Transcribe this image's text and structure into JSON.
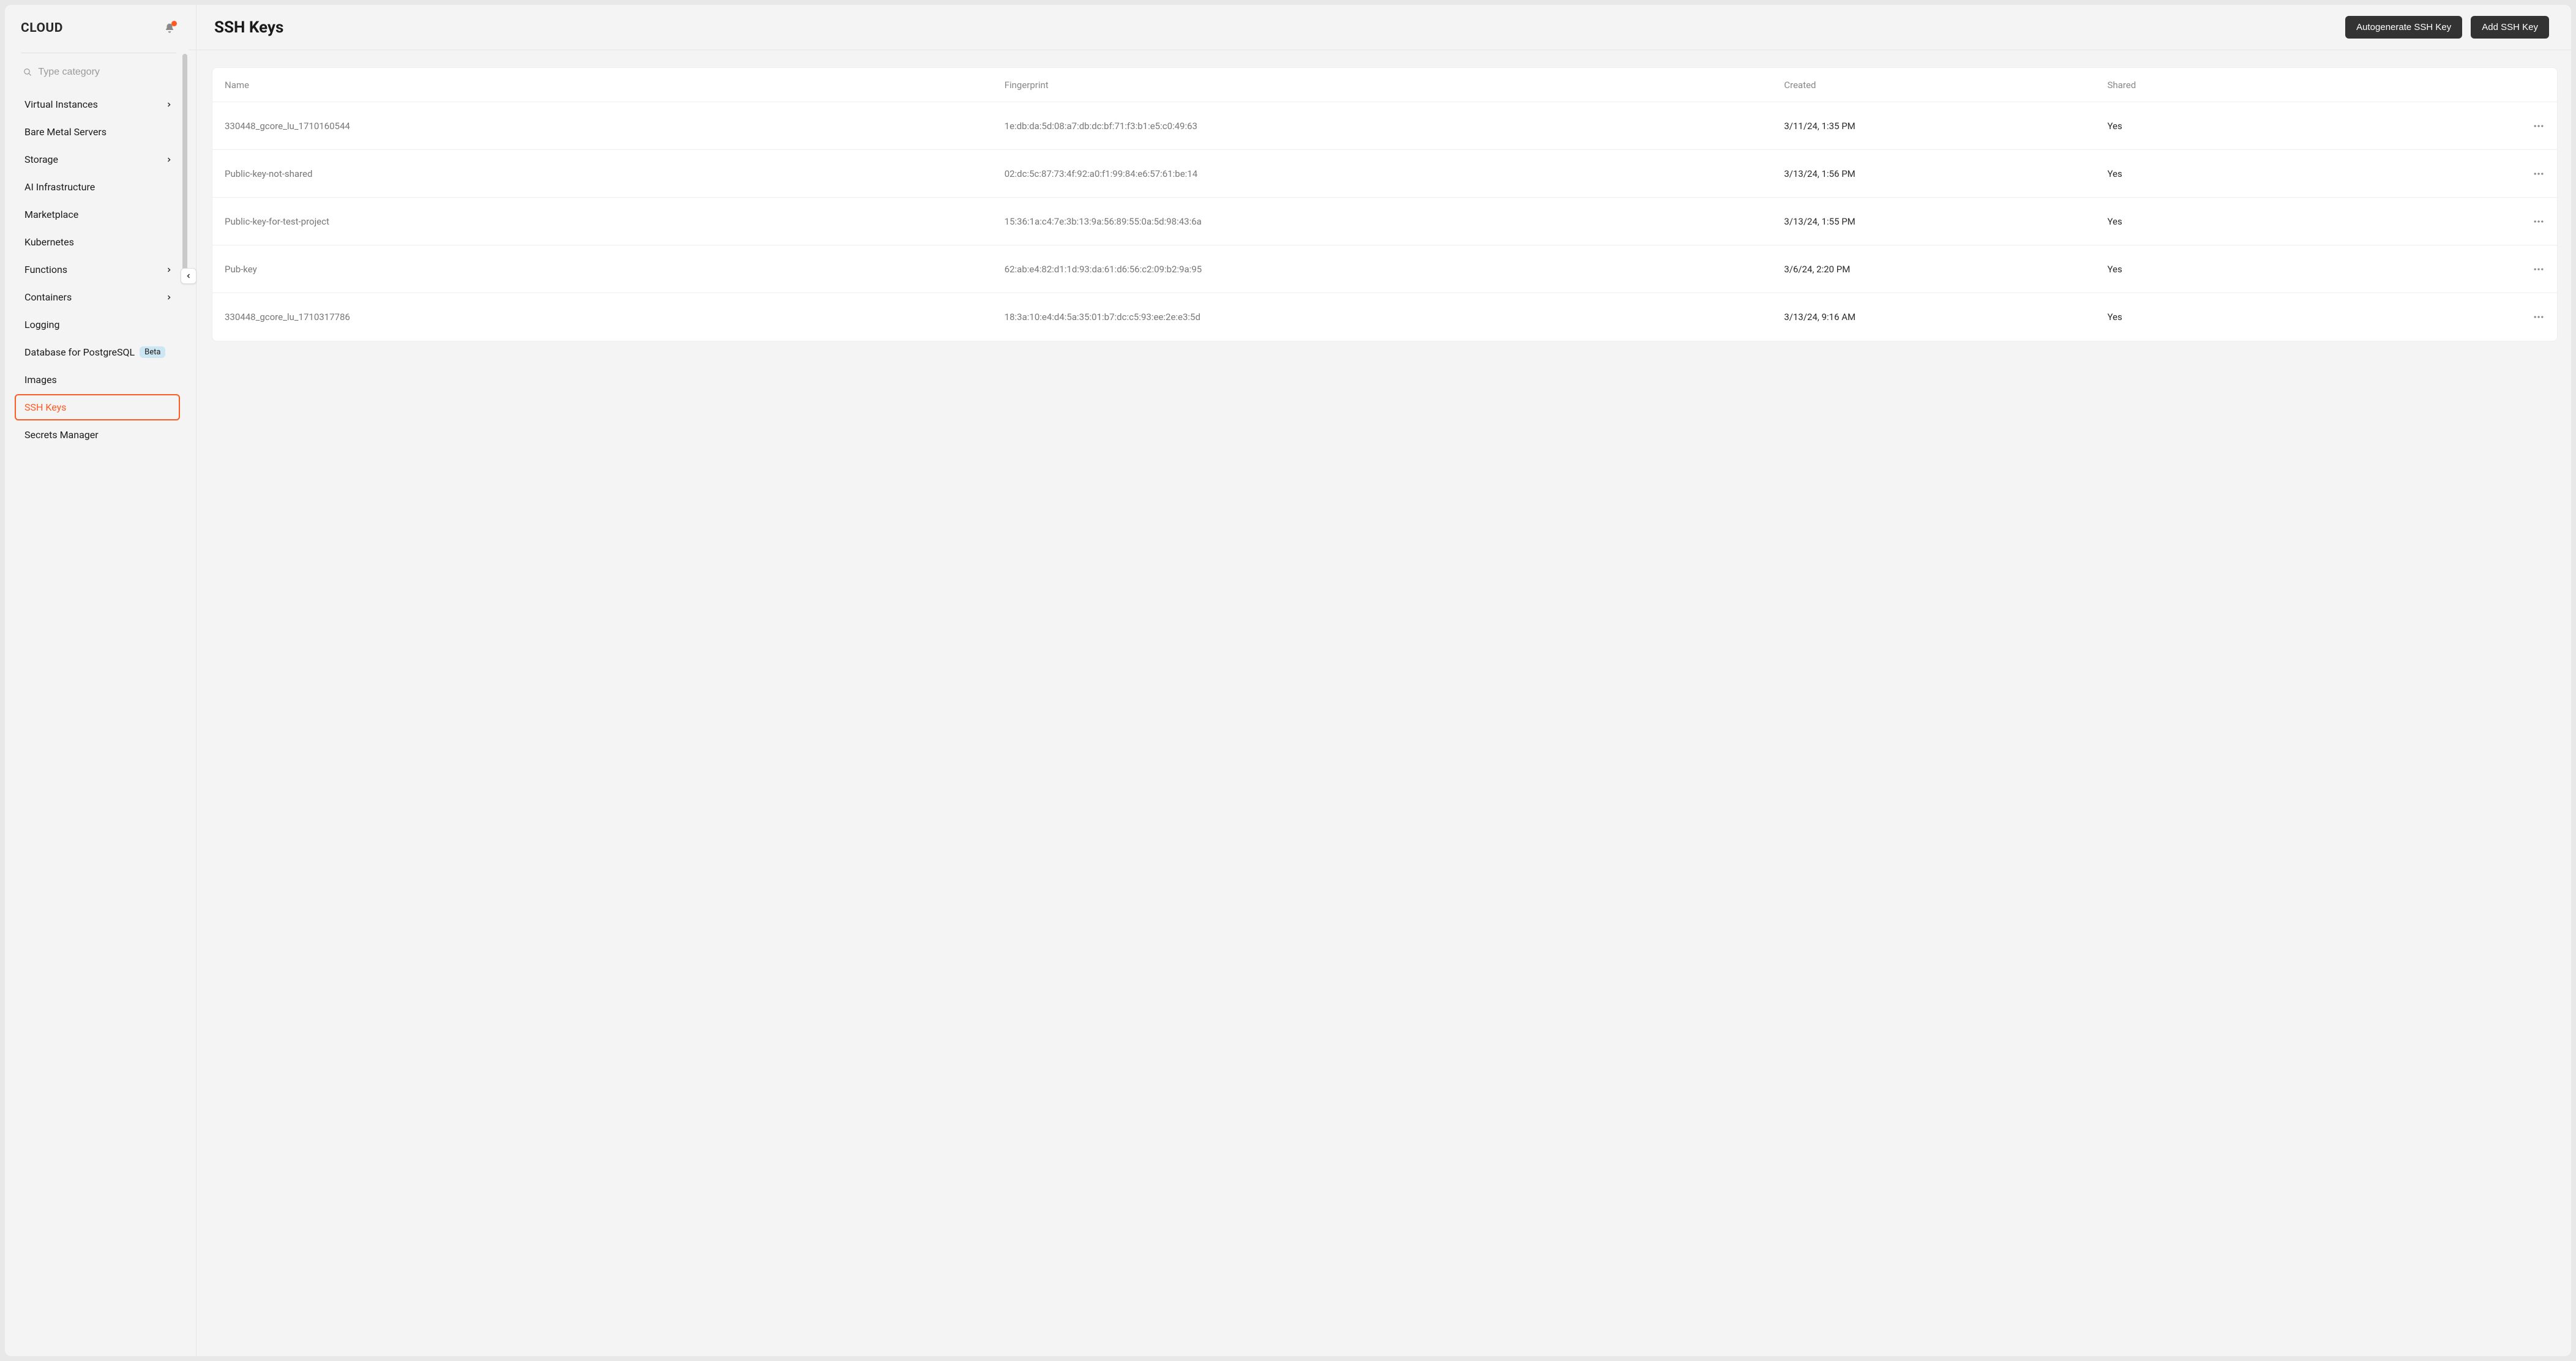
{
  "brand": "CLOUD",
  "search": {
    "placeholder": "Type category"
  },
  "sidebar": {
    "items": [
      {
        "label": "Virtual Instances",
        "chevron": true
      },
      {
        "label": "Bare Metal Servers"
      },
      {
        "label": "Storage",
        "chevron": true
      },
      {
        "label": "AI Infrastructure"
      },
      {
        "label": "Marketplace"
      },
      {
        "label": "Kubernetes"
      },
      {
        "label": "Functions",
        "chevron": true
      },
      {
        "label": "Containers",
        "chevron": true
      },
      {
        "label": "Logging"
      },
      {
        "label": "Database for PostgreSQL",
        "badge": "Beta"
      },
      {
        "label": "Images"
      },
      {
        "label": "SSH Keys",
        "active": true
      },
      {
        "label": "Secrets Manager"
      }
    ]
  },
  "page": {
    "title": "SSH Keys",
    "actions": {
      "autogen": "Autogenerate SSH Key",
      "add": "Add SSH Key"
    }
  },
  "table": {
    "headers": {
      "name": "Name",
      "fingerprint": "Fingerprint",
      "created": "Created",
      "shared": "Shared"
    },
    "rows": [
      {
        "name": "330448_gcore_lu_1710160544",
        "fingerprint": "1e:db:da:5d:08:a7:db:dc:bf:71:f3:b1:e5:c0:49:63",
        "created": "3/11/24, 1:35 PM",
        "shared": "Yes"
      },
      {
        "name": "Public-key-not-shared",
        "fingerprint": "02:dc:5c:87:73:4f:92:a0:f1:99:84:e6:57:61:be:14",
        "created": "3/13/24, 1:56 PM",
        "shared": "Yes"
      },
      {
        "name": "Public-key-for-test-project",
        "fingerprint": "15:36:1a:c4:7e:3b:13:9a:56:89:55:0a:5d:98:43:6a",
        "created": "3/13/24, 1:55 PM",
        "shared": "Yes"
      },
      {
        "name": "Pub-key",
        "fingerprint": "62:ab:e4:82:d1:1d:93:da:61:d6:56:c2:09:b2:9a:95",
        "created": "3/6/24, 2:20 PM",
        "shared": "Yes"
      },
      {
        "name": "330448_gcore_lu_1710317786",
        "fingerprint": "18:3a:10:e4:d4:5a:35:01:b7:dc:c5:93:ee:2e:e3:5d",
        "created": "3/13/24, 9:16 AM",
        "shared": "Yes"
      }
    ]
  }
}
